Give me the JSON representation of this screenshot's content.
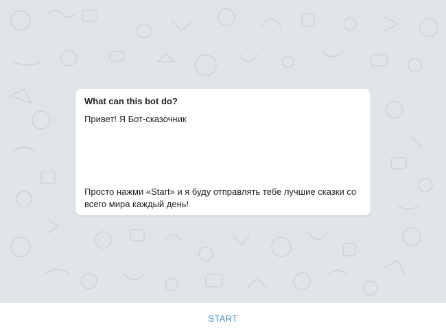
{
  "bot_info": {
    "title": "What can this bot do?",
    "greeting": "Привет! Я Бот-сказочник",
    "description": "Просто нажми «Start» и я буду отправлять тебе лучшие сказки со всего мира каждый день!"
  },
  "bottom_bar": {
    "start_label": "START"
  },
  "colors": {
    "accent": "#3a8dcc",
    "chat_background": "#e0e5e9",
    "doodle": "#cdd3d8"
  }
}
